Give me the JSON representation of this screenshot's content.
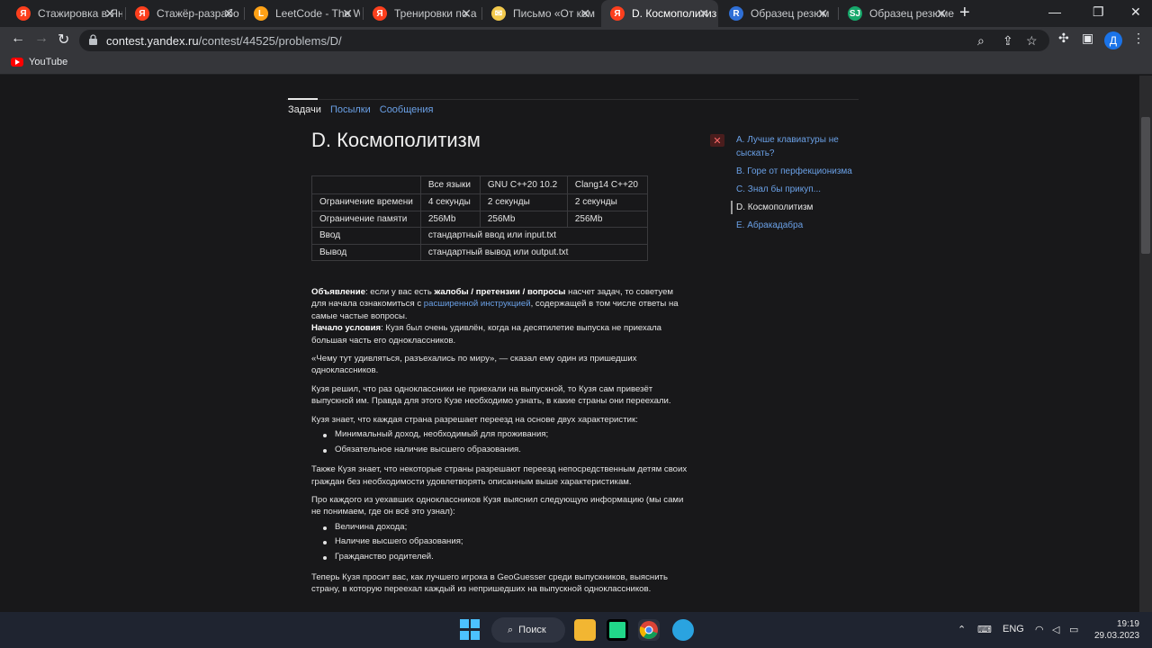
{
  "browser": {
    "tabs": [
      {
        "title": "Стажировка в Ян",
        "icon": "yandex-icon",
        "icon_text": "Я",
        "icon_color": "#fc3f1d"
      },
      {
        "title": "Стажёр-разрабо",
        "icon": "yandex-icon",
        "icon_text": "Я",
        "icon_color": "#fc3f1d"
      },
      {
        "title": "LeetCode - The W",
        "icon": "leetcode-icon",
        "icon_text": "L",
        "icon_color": "#ffa116"
      },
      {
        "title": "Тренировки по а",
        "icon": "yandex-icon",
        "icon_text": "Я",
        "icon_color": "#fc3f1d"
      },
      {
        "title": "Письмо «От ком",
        "icon": "mail-icon",
        "icon_text": "✉",
        "icon_color": "#f2c94c"
      },
      {
        "title": "D. Космополитиз",
        "icon": "yandex-icon",
        "icon_text": "Я",
        "icon_color": "#fc3f1d",
        "active": true
      },
      {
        "title": "Образец резюм",
        "icon": "doc-icon",
        "icon_text": "R",
        "icon_color": "#2f6fd6"
      },
      {
        "title": "Образец резюме",
        "icon": "sj-icon",
        "icon_text": "SJ",
        "icon_color": "#17a86b"
      }
    ],
    "url_host": "contest.yandex.ru",
    "url_path": "/contest/44525/problems/D/",
    "profile_initial": "Д",
    "bookmark": "YouTube"
  },
  "contest": {
    "nav": [
      "Задачи",
      "Посылки",
      "Сообщения"
    ],
    "problem_title": "D. Космополитизм",
    "limits": {
      "header": [
        "",
        "Все языки",
        "GNU C++20 10.2",
        "Clang14 C++20"
      ],
      "rows": [
        [
          "Ограничение времени",
          "4 секунды",
          "2 секунды",
          "2 секунды"
        ],
        [
          "Ограничение памяти",
          "256Mb",
          "256Mb",
          "256Mb"
        ]
      ],
      "io": [
        [
          "Ввод",
          "стандартный ввод или input.txt"
        ],
        [
          "Вывод",
          "стандартный вывод или output.txt"
        ]
      ]
    },
    "statement": {
      "announce_label": "Объявление",
      "announce_1": ": если у вас есть ",
      "announce_bold": "жалобы / претензии / вопросы",
      "announce_2": " насчет задач, то советуем для начала ознакомиться с ",
      "announce_link": "расширенной инструкцией",
      "announce_3": ", содержащей в том числе ответы на самые частые вопросы.",
      "start_label": "Начало условия",
      "start_text": ": Кузя был очень удивлён, когда на десятилетие выпуска не приехала большая часть его одноклассников.",
      "p2": "«Чему тут удивляться, разъехались по миру», — сказал ему один из пришедших одноклассников.",
      "p3": "Кузя решил, что раз одноклассники не приехали на выпускной, то Кузя сам привезёт выпускной им. Правда для этого Кузе необходимо узнать, в какие страны они переехали.",
      "p4": "Кузя знает, что каждая страна разрешает переезд на основе двух характеристик:",
      "list1": [
        "Минимальный доход, необходимый для проживания;",
        "Обязательное наличие высшего образования."
      ],
      "p5": "Также Кузя знает, что некоторые страны разрешают переезд непосредственным детям своих граждан без необходимости удовлетворять описанным выше характеристикам.",
      "p6": "Про каждого из уехавших одноклассников Кузя выяснил следующую информацию (мы сами не понимаем, где он всё это узнал):",
      "list2": [
        "Величина дохода;",
        "Наличие высшего образования;",
        "Гражданство родителей."
      ],
      "p7": "Теперь Кузя просит вас, как лучшего игрока в GeoGuesser среди выпускников, выяснить страну, в которую переехал каждый из непришедших на выпускной одноклассников."
    },
    "problems": [
      {
        "label": "A. Лучше клавиатуры не сыскать?"
      },
      {
        "label": "B. Горе от перфекционизма"
      },
      {
        "label": "C. Знал бы прикуп..."
      },
      {
        "label": "D. Космополитизм",
        "active": true
      },
      {
        "label": "E. Абракадабра"
      }
    ]
  },
  "taskbar": {
    "search_label": "Поиск",
    "lang": "ENG",
    "time": "19:19",
    "date": "29.03.2023"
  }
}
